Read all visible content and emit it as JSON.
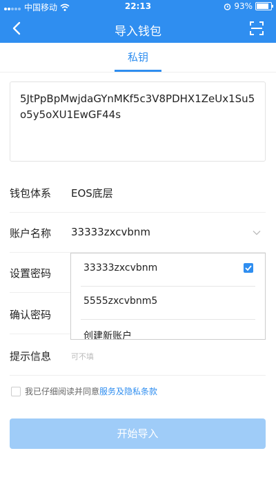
{
  "status_bar": {
    "carrier": "中国移动",
    "time": "22:13",
    "battery": "93%",
    "battery_level": 0.93
  },
  "nav": {
    "title": "导入钱包"
  },
  "tabs": [
    {
      "label": "私钥",
      "active": true
    }
  ],
  "private_key": {
    "value": "5JtPpBpMwjdaGYnMKf5c3V8PDHX1ZeUx1Su5o5y5oXU1EwGF44s"
  },
  "form": {
    "wallet_system": {
      "label": "钱包体系",
      "value": "EOS底层"
    },
    "account_name": {
      "label": "账户名称",
      "value": "33333zxcvbnm"
    },
    "set_password": {
      "label": "设置密码"
    },
    "confirm_password": {
      "label": "确认密码"
    },
    "hint": {
      "label": "提示信息",
      "placeholder": "可不填"
    }
  },
  "account_dropdown": {
    "options": [
      {
        "label": "33333zxcvbnm",
        "selected": true
      },
      {
        "label": "5555zxcvbnm5",
        "selected": false
      },
      {
        "label": "创建新账户",
        "selected": false
      }
    ]
  },
  "agreement": {
    "text": "我已仔细阅读并同意",
    "link": "服务及隐私条款"
  },
  "submit_button": {
    "label": "开始导入"
  },
  "colors": {
    "accent": "#2f8ef0",
    "button_disabled": "#9fccf8"
  }
}
